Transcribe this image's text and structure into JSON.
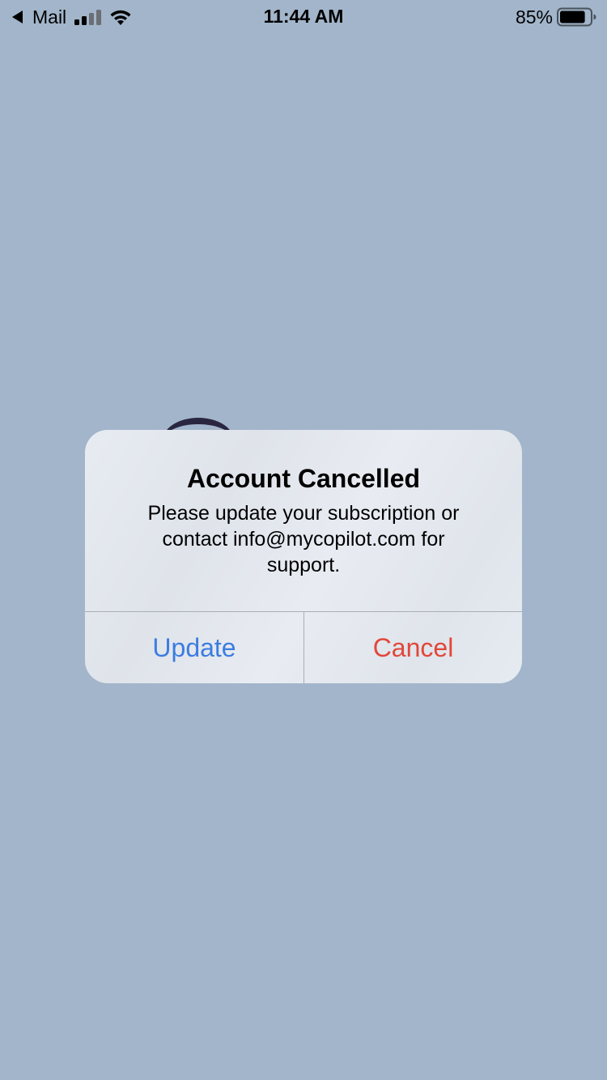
{
  "status_bar": {
    "back_app": "Mail",
    "time": "11:44 AM",
    "battery_percent": "85%",
    "battery_level": 0.85,
    "signal_bars_active": 2,
    "signal_bars_total": 4,
    "icons": [
      "back-arrow-icon",
      "signal-icon",
      "wifi-icon",
      "battery-icon"
    ]
  },
  "alert": {
    "title": "Account Cancelled",
    "message": "Please update your subscription or contact info@mycopilot.com for support.",
    "buttons": {
      "update_label": "Update",
      "cancel_label": "Cancel"
    }
  },
  "colors": {
    "background": "#a2b5ca",
    "update_button": "#3b7de0",
    "cancel_button": "#e0483a"
  }
}
